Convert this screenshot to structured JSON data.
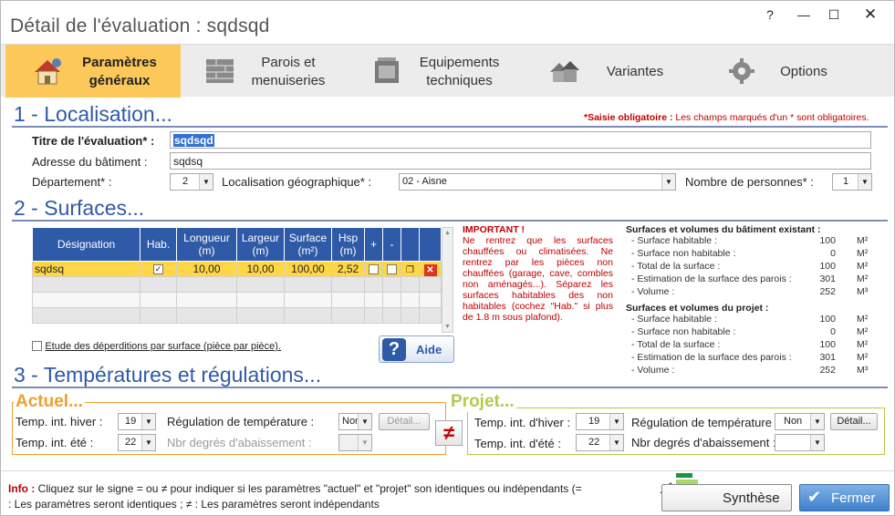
{
  "window": {
    "title": "Détail de l'évaluation : sqdsqd",
    "help_btn": "?",
    "minimize_btn": "—",
    "maximize_btn": "☐",
    "close_btn": "✕"
  },
  "tabs": [
    {
      "label_line1": "Paramètres",
      "label_line2": "généraux",
      "active": true
    },
    {
      "label_line1": "Parois et",
      "label_line2": "menuiseries",
      "active": false
    },
    {
      "label_line1": "Equipements",
      "label_line2": "techniques",
      "active": false
    },
    {
      "label_line1": "Variantes",
      "label_line2": "",
      "active": false
    },
    {
      "label_line1": "Options",
      "label_line2": "",
      "active": false
    }
  ],
  "localisation": {
    "section_title": "1 - Localisation...",
    "required_note_bold": "*Saisie obligatoire :",
    "required_note_rest": " Les champs marqués d'un * sont obligatoires.",
    "title_label": "Titre de l'évaluation* :",
    "title_value": "sqdsqd",
    "address_label": "Adresse du bâtiment :",
    "address_value": "sqdsq",
    "dept_label": "Département* :",
    "dept_value": "2",
    "geo_label": "Localisation géographique* :",
    "geo_value": "02 - Aisne",
    "persons_label": "Nombre de personnes* :",
    "persons_value": "1"
  },
  "surfaces": {
    "section_title": "2 - Surfaces...",
    "columns": [
      "Désignation",
      "Hab.",
      "Longueur (m)",
      "Largeur (m)",
      "Surface (m²)",
      "Hsp (m)",
      "+",
      "-"
    ],
    "rows": [
      {
        "designation": "sqdsq",
        "hab": true,
        "longueur": "10,00",
        "largeur": "10,00",
        "surface": "100,00",
        "hsp": "2,52"
      }
    ],
    "checkbox_label": "Etude des déperditions par surface (pièce par pièce).",
    "aide_label": "Aide",
    "important_title": "IMPORTANT !",
    "important_text": "Ne rentrez que les surfaces chauffées ou climatisées. Ne rentrez par les pièces non chauffées (garage, cave, combles non aménagés...). Séparez les surfaces habitables des non habitables (cochez \"Hab.\" si plus de 1.8 m sous plafond).",
    "existing": {
      "title": "Surfaces et volumes du bâtiment existant :",
      "rows": [
        {
          "k": "- Surface habitable :",
          "v": "100",
          "u": "M²"
        },
        {
          "k": "- Surface non habitable :",
          "v": "0",
          "u": "M²"
        },
        {
          "k": "- Total de la surface :",
          "v": "100",
          "u": "M²"
        },
        {
          "k": "- Estimation de la surface des parois :",
          "v": "301",
          "u": "M²"
        },
        {
          "k": "- Volume :",
          "v": "252",
          "u": "M³"
        }
      ]
    },
    "project": {
      "title": "Surfaces et volumes du projet :",
      "rows": [
        {
          "k": "- Surface habitable :",
          "v": "100",
          "u": "M²"
        },
        {
          "k": "- Surface non habitable :",
          "v": "0",
          "u": "M²"
        },
        {
          "k": "- Total de la surface :",
          "v": "100",
          "u": "M²"
        },
        {
          "k": "- Estimation de la surface des parois :",
          "v": "301",
          "u": "M²"
        },
        {
          "k": "- Volume :",
          "v": "252",
          "u": "M³"
        }
      ]
    }
  },
  "temperatures": {
    "section_title": "3 - Températures et régulations...",
    "actuel": {
      "title": "Actuel...",
      "hiver_label": "Temp. int. hiver :",
      "hiver_value": "19",
      "ete_label": "Temp. int. été :",
      "ete_value": "22",
      "regulation_label": "Régulation de température :",
      "regulation_value": "Non",
      "detail_btn": "Détail...",
      "abaissement_label": "Nbr degrés d'abaissement :",
      "abaissement_value": ""
    },
    "neq_label": "≠",
    "projet": {
      "title": "Projet...",
      "hiver_label": "Temp. int. d'hiver :",
      "hiver_value": "19",
      "ete_label": "Temp. int. d'été :",
      "ete_value": "22",
      "regulation_label": "Régulation de température :",
      "regulation_value": "Non",
      "detail_btn": "Détail...",
      "abaissement_label": "Nbr degrés d'abaissement :",
      "abaissement_value": ""
    }
  },
  "footer": {
    "info_bold": "Info :",
    "info_text": " Cliquez sur le signe = ou ≠ pour indiquer si les paramètres \"actuel\" et \"projet\" son identiques ou indépendants (= : Les paramètres seront identiques ; ≠ : Les paramètres seront indépendants",
    "synthese_btn": "Synthèse",
    "fermer_btn": "Fermer"
  },
  "colors": {
    "accent": "#2f5aa8",
    "tab_active": "#fdc85a",
    "actuel": "#f0a030",
    "projet": "#b5c94a",
    "required": "#c00000"
  }
}
